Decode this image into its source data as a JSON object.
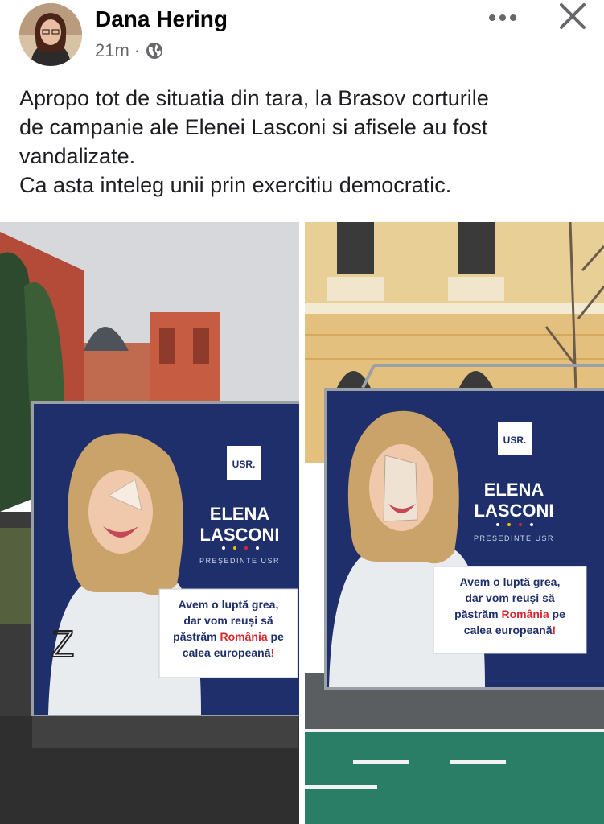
{
  "post": {
    "author": "Dana Hering",
    "timestamp": "21m",
    "separator": "·",
    "audience_icon": "globe-icon",
    "lines": [
      "Apropo tot de situatia din tara, la Brasov corturile",
      "de campanie ale Elenei Lasconi si afisele au fost",
      "vandalizate.",
      "Ca asta inteleg unii prin exercitiu democratic."
    ]
  },
  "header": {
    "more_icon": "more-options-icon",
    "close_icon": "close-icon"
  },
  "photos": {
    "left": {
      "party_logo": "USR.",
      "name_first": "ELENA",
      "name_last": "LASCONI",
      "role": "PREȘEDINTE USR",
      "slogan_line1": "Avem o luptă grea,",
      "slogan_line2": "dar vom reuși să",
      "slogan_line3_a": "păstrăm ",
      "slogan_line3_b": "România",
      "slogan_line3_c": " pe",
      "slogan_line4_a": "calea europeană",
      "slogan_line4_b": "!",
      "graffiti": "Z"
    },
    "right": {
      "party_logo": "USR.",
      "name_first": "ELENA",
      "name_last": "LASCONI",
      "role": "PREȘEDINTE USR",
      "slogan_line1": "Avem o luptă grea,",
      "slogan_line2": "dar vom reuși să",
      "slogan_line3_a": "păstrăm ",
      "slogan_line3_b": "România",
      "slogan_line3_c": " pe",
      "slogan_line4_a": "calea europeană",
      "slogan_line4_b": "!"
    }
  },
  "colors": {
    "banner_blue": "#1e2f6b",
    "accent_red": "#d8272f",
    "meta_gray": "#65676b"
  }
}
